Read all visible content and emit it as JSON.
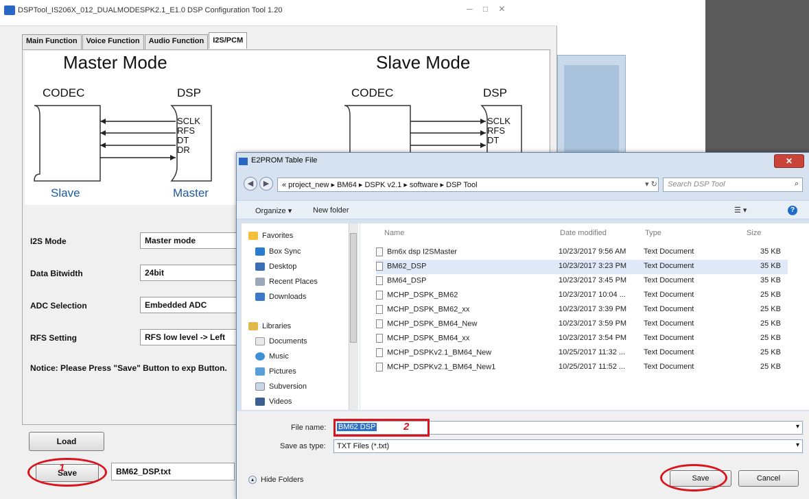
{
  "app": {
    "title": "DSPTool_IS206X_012_DUALMODESPK2.1_E1.0 DSP Configuration Tool 1.20",
    "window_controls": "─ □ ✕",
    "tabs": [
      {
        "label": "Main Function",
        "active": false
      },
      {
        "label": "Voice Function",
        "active": false
      },
      {
        "label": "Audio Function",
        "active": false
      },
      {
        "label": "I2S/PCM",
        "active": true
      }
    ],
    "diagram": {
      "master": {
        "title": "Master Mode",
        "left_label": "CODEC",
        "right_label": "DSP",
        "left_role": "Slave",
        "right_role": "Master"
      },
      "slave": {
        "title": "Slave Mode",
        "left_label": "CODEC",
        "right_label": "DSP"
      },
      "signals": [
        "SCLK",
        "RFS",
        "DT",
        "DR"
      ]
    },
    "settings": [
      {
        "label": "I2S Mode",
        "value": "Master mode"
      },
      {
        "label": "Data Bitwidth",
        "value": "24bit"
      },
      {
        "label": "ADC Selection",
        "value": "Embedded ADC"
      },
      {
        "label": "RFS Setting",
        "value": "RFS low level -> Left"
      }
    ],
    "notice": "Notice: Please Press \"Save\" Button to exp Button.",
    "load_label": "Load",
    "save_label": "Save",
    "filename": "BM62_DSP.txt",
    "annotation_1": "1"
  },
  "dialog": {
    "title": "E2PROM Table File",
    "close": "✕",
    "address": "« project_new ▸ BM64 ▸ DSPK v2.1 ▸ software ▸ DSP Tool",
    "search_placeholder": "Search DSP Tool",
    "toolbar": {
      "organize": "Organize ▾",
      "new_folder": "New folder",
      "view": "☰ ▾",
      "help": "?"
    },
    "nav": {
      "favorites": {
        "header": "Favorites",
        "items": [
          "Box Sync",
          "Desktop",
          "Recent Places",
          "Downloads"
        ]
      },
      "libraries": {
        "header": "Libraries",
        "items": [
          "Documents",
          "Music",
          "Pictures",
          "Subversion",
          "Videos"
        ]
      }
    },
    "columns": {
      "name": "Name",
      "date": "Date modified",
      "type": "Type",
      "size": "Size"
    },
    "files": [
      {
        "name": "Bm6x dsp I2SMaster",
        "date": "10/23/2017 9:56 AM",
        "type": "Text Document",
        "size": "35 KB"
      },
      {
        "name": "BM62_DSP",
        "date": "10/23/2017 3:23 PM",
        "type": "Text Document",
        "size": "35 KB"
      },
      {
        "name": "BM64_DSP",
        "date": "10/23/2017 3:45 PM",
        "type": "Text Document",
        "size": "35 KB"
      },
      {
        "name": "MCHP_DSPK_BM62",
        "date": "10/23/2017 10:04 ...",
        "type": "Text Document",
        "size": "25 KB"
      },
      {
        "name": "MCHP_DSPK_BM62_xx",
        "date": "10/23/2017 3:39 PM",
        "type": "Text Document",
        "size": "25 KB"
      },
      {
        "name": "MCHP_DSPK_BM64_New",
        "date": "10/23/2017 3:59 PM",
        "type": "Text Document",
        "size": "25 KB"
      },
      {
        "name": "MCHP_DSPK_BM64_xx",
        "date": "10/23/2017 3:54 PM",
        "type": "Text Document",
        "size": "25 KB"
      },
      {
        "name": "MCHP_DSPKv2.1_BM64_New",
        "date": "10/25/2017 11:32 ...",
        "type": "Text Document",
        "size": "25 KB"
      },
      {
        "name": "MCHP_DSPKv2.1_BM64_New1",
        "date": "10/25/2017 11:52 ...",
        "type": "Text Document",
        "size": "25 KB"
      }
    ],
    "file_name_label": "File name:",
    "file_name_value": "BM62 DSP",
    "save_type_label": "Save as type:",
    "save_type_value": "TXT Files (*.txt)",
    "hide_folders": "Hide Folders",
    "save_button": "Save",
    "cancel_button": "Cancel",
    "annotation_2": "2"
  }
}
